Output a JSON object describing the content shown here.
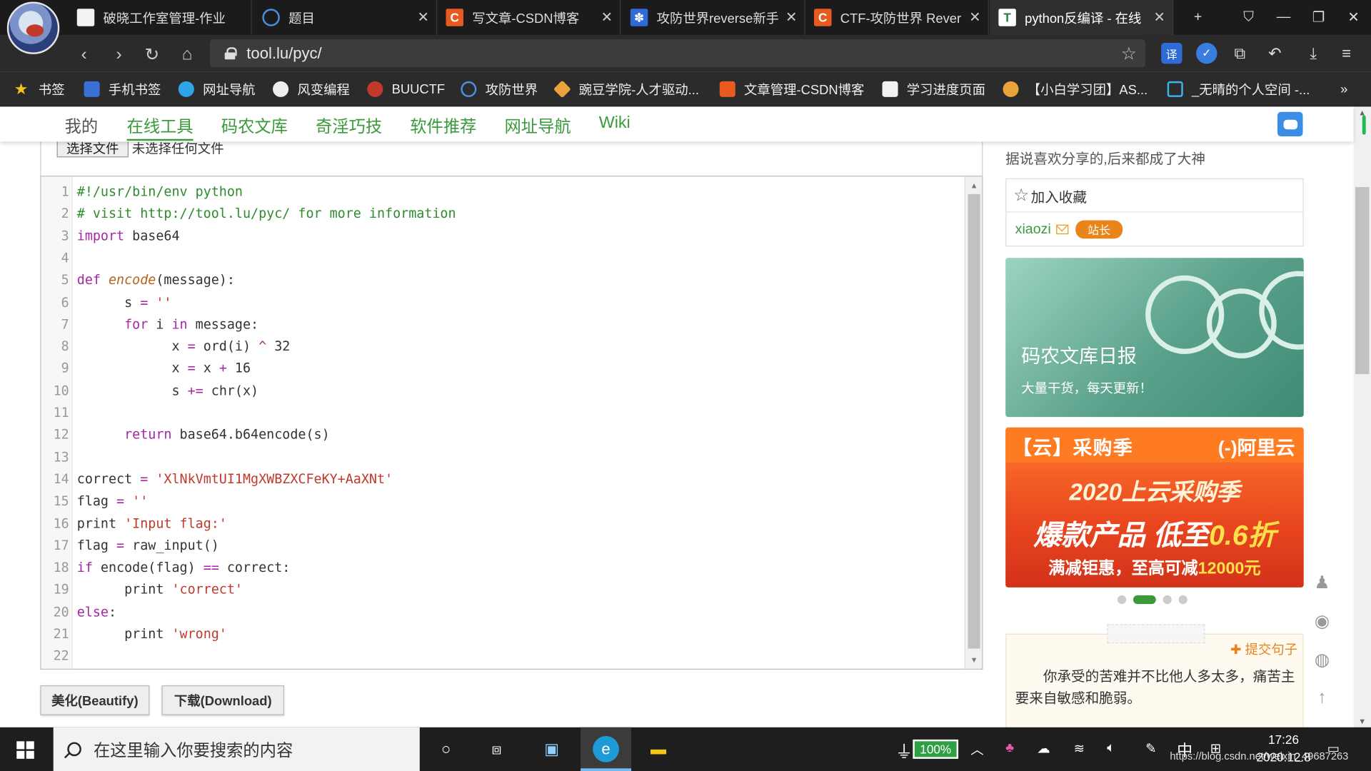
{
  "browser": {
    "tabs": [
      {
        "label": "破晓工作室管理-作业",
        "icon": "doc"
      },
      {
        "label": "题目",
        "icon": "globe"
      },
      {
        "label": "写文章-CSDN博客",
        "icon": "csdn"
      },
      {
        "label": "攻防世界reverse新手",
        "icon": "baidu-paw"
      },
      {
        "label": "CTF-攻防世界 Rever",
        "icon": "csdn"
      },
      {
        "label": "python反编译 - 在线",
        "icon": "tool-lu"
      }
    ],
    "new_tab_symbol": "+",
    "close_symbol": "✕",
    "url": "tool.lu/pyc/",
    "ext_translate_label": "译",
    "bookmarks": [
      {
        "label": "书签",
        "icon": "star"
      },
      {
        "label": "手机书签",
        "icon": "phone"
      },
      {
        "label": "网址导航",
        "icon": "ie-e"
      },
      {
        "label": "风变编程",
        "icon": "fengbian"
      },
      {
        "label": "BUUCTF",
        "icon": "buuctf"
      },
      {
        "label": "攻防世界",
        "icon": "globe"
      },
      {
        "label": "豌豆学院-人才驱动...",
        "icon": "wandou"
      },
      {
        "label": "文章管理-CSDN博客",
        "icon": "csdn"
      },
      {
        "label": "学习进度页面",
        "icon": "doc"
      },
      {
        "label": "【小白学习团】AS...",
        "icon": "hex"
      },
      {
        "label": "_无晴的个人空间 -...",
        "icon": "bilibili"
      }
    ],
    "bookmarks_more": "»"
  },
  "site": {
    "nav": [
      "我的",
      "在线工具",
      "码农文库",
      "奇淫巧技",
      "软件推荐",
      "网址导航",
      "Wiki"
    ],
    "active_nav_index": 1
  },
  "upload": {
    "choose_button": "选择文件",
    "no_file_label": "未选择任何文件"
  },
  "code": {
    "lines": [
      [
        {
          "t": "#!/usr/bin/env python",
          "c": "comment"
        }
      ],
      [
        {
          "t": "# visit http://tool.lu/pyc/ for more information",
          "c": "comment"
        }
      ],
      [
        {
          "t": "import",
          "c": "kw"
        },
        {
          "t": " base64",
          "c": "plain"
        }
      ],
      [
        {
          "t": "",
          "c": "plain"
        }
      ],
      [
        {
          "t": "def",
          "c": "kw"
        },
        {
          "t": " ",
          "c": "plain"
        },
        {
          "t": "encode",
          "c": "fn"
        },
        {
          "t": "(message):",
          "c": "plain"
        }
      ],
      [
        {
          "t": "      s ",
          "c": "plain"
        },
        {
          "t": "=",
          "c": "op"
        },
        {
          "t": " ",
          "c": "plain"
        },
        {
          "t": "''",
          "c": "str"
        }
      ],
      [
        {
          "t": "      ",
          "c": "plain"
        },
        {
          "t": "for",
          "c": "kw"
        },
        {
          "t": " i ",
          "c": "plain"
        },
        {
          "t": "in",
          "c": "kw"
        },
        {
          "t": " message:",
          "c": "plain"
        }
      ],
      [
        {
          "t": "            x ",
          "c": "plain"
        },
        {
          "t": "=",
          "c": "op"
        },
        {
          "t": " ord(i) ",
          "c": "plain"
        },
        {
          "t": "^",
          "c": "op"
        },
        {
          "t": " 32",
          "c": "plain"
        }
      ],
      [
        {
          "t": "            x ",
          "c": "plain"
        },
        {
          "t": "=",
          "c": "op"
        },
        {
          "t": " x ",
          "c": "plain"
        },
        {
          "t": "+",
          "c": "op"
        },
        {
          "t": " 16",
          "c": "plain"
        }
      ],
      [
        {
          "t": "            s ",
          "c": "plain"
        },
        {
          "t": "+=",
          "c": "op"
        },
        {
          "t": " chr(x)",
          "c": "plain"
        }
      ],
      [
        {
          "t": "",
          "c": "plain"
        }
      ],
      [
        {
          "t": "      ",
          "c": "plain"
        },
        {
          "t": "return",
          "c": "kw"
        },
        {
          "t": " base64.b64encode(s)",
          "c": "plain"
        }
      ],
      [
        {
          "t": "",
          "c": "plain"
        }
      ],
      [
        {
          "t": "correct ",
          "c": "plain"
        },
        {
          "t": "=",
          "c": "op"
        },
        {
          "t": " ",
          "c": "plain"
        },
        {
          "t": "'XlNkVmtUI1MgXWBZXCFeKY+AaXNt'",
          "c": "str"
        }
      ],
      [
        {
          "t": "flag ",
          "c": "plain"
        },
        {
          "t": "=",
          "c": "op"
        },
        {
          "t": " ",
          "c": "plain"
        },
        {
          "t": "''",
          "c": "str"
        }
      ],
      [
        {
          "t": "print ",
          "c": "plain"
        },
        {
          "t": "'Input flag:'",
          "c": "str"
        }
      ],
      [
        {
          "t": "flag ",
          "c": "plain"
        },
        {
          "t": "=",
          "c": "op"
        },
        {
          "t": " raw_input()",
          "c": "plain"
        }
      ],
      [
        {
          "t": "if",
          "c": "kw"
        },
        {
          "t": " encode(flag) ",
          "c": "plain"
        },
        {
          "t": "==",
          "c": "op"
        },
        {
          "t": " correct:",
          "c": "plain"
        }
      ],
      [
        {
          "t": "      print ",
          "c": "plain"
        },
        {
          "t": "'correct'",
          "c": "str"
        }
      ],
      [
        {
          "t": "else",
          "c": "kw"
        },
        {
          "t": ":",
          "c": "plain"
        }
      ],
      [
        {
          "t": "      print ",
          "c": "plain"
        },
        {
          "t": "'wrong'",
          "c": "str"
        }
      ],
      [
        {
          "t": "",
          "c": "plain"
        }
      ]
    ],
    "colors": {
      "comment": "#2e8b2e",
      "kw": "#a626a4",
      "fn": "#b5651d",
      "str": "#c0392b",
      "op": "#a626a4",
      "plain": "#333333"
    }
  },
  "actions": {
    "beautify_label": "美化(Beautify)",
    "download_label": "下载(Download)"
  },
  "sidebar": {
    "slogan": "据说喜欢分享的,后来都成了大神",
    "favorite_label": "加入收藏",
    "user": "xiaozi",
    "role_badge": "站长",
    "banner1": {
      "title": "码农文库日报",
      "subtitle": "大量干货，每天更新！"
    },
    "banner2": {
      "tag": "【云】采购季",
      "brand": "(-)阿里云",
      "line1": "2020上云采购季",
      "line2_a": "爆款产品 低至",
      "line2_b": "0.6折",
      "line3_a": "满减钜惠，至高可减",
      "line3_b": "12000元"
    },
    "carousel": {
      "count": 4,
      "active_index": 1
    },
    "quote": {
      "submit_label": "✚ 提交句子",
      "text": "你承受的苦难并不比他人多太多，痛苦主要来自敏感和脆弱。"
    }
  },
  "taskbar": {
    "search_placeholder": "在这里输入你要搜索的内容",
    "battery": "100%",
    "ime": "中",
    "time": "17:26",
    "date": "2020.12.8",
    "watermark": "https://blog.csdn.net/weixin_49687263"
  }
}
